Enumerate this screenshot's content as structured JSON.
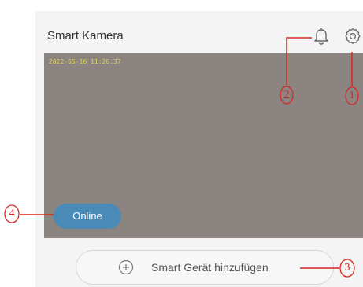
{
  "header": {
    "title": "Smart Kamera",
    "notification_icon": "bell-icon",
    "settings_icon": "gear-icon"
  },
  "feed": {
    "timestamp": "2022-05-16 11:26:37",
    "status": "Online"
  },
  "add_device": {
    "icon": "plus-circle-icon",
    "label": "Smart Gerät hinzufügen"
  },
  "callouts": {
    "one": "1",
    "two": "2",
    "three": "3",
    "four": "4"
  },
  "colors": {
    "callout": "#d8261f",
    "status_badge": "#4a8ab7",
    "timestamp": "#e5d34e"
  }
}
